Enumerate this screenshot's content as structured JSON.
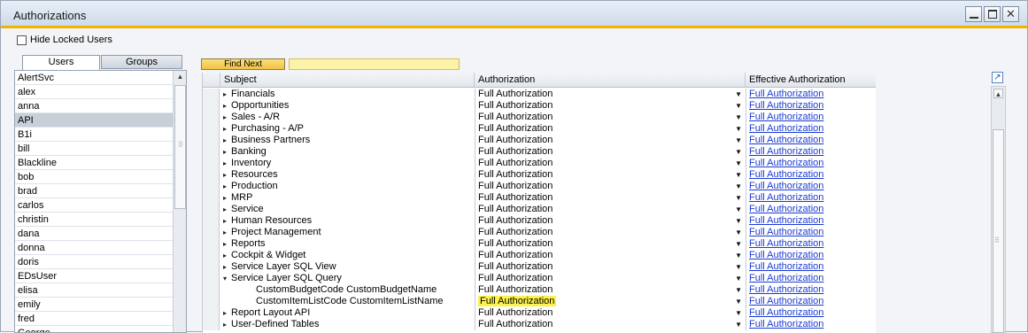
{
  "window": {
    "title": "Authorizations",
    "minimize_glyph": "",
    "maximize_glyph": "",
    "close_glyph": "✕"
  },
  "filter": {
    "hide_locked_label": "Hide Locked Users",
    "hide_locked_checked": false
  },
  "tabs": [
    {
      "label": "Users",
      "active": true
    },
    {
      "label": "Groups",
      "active": false
    }
  ],
  "users": [
    "AlertSvc",
    "alex",
    "anna",
    "API",
    "B1i",
    "bill",
    "Blackline",
    "bob",
    "brad",
    "carlos",
    "christin",
    "dana",
    "donna",
    "doris",
    "EDsUser",
    "elisa",
    "emily",
    "fred",
    "George"
  ],
  "selected_user": "API",
  "find": {
    "button_label": "Find Next",
    "field_value": ""
  },
  "grid": {
    "columns": {
      "subject": "Subject",
      "authorization": "Authorization",
      "effective": "Effective Authorization"
    },
    "rows": [
      {
        "subject": "Financials",
        "auth": "Full Authorization",
        "eff": "Full Authorization",
        "exp": "▸",
        "child": false
      },
      {
        "subject": "Opportunities",
        "auth": "Full Authorization",
        "eff": "Full Authorization",
        "exp": "▸",
        "child": false
      },
      {
        "subject": "Sales - A/R",
        "auth": "Full Authorization",
        "eff": "Full Authorization",
        "exp": "▸",
        "child": false
      },
      {
        "subject": "Purchasing - A/P",
        "auth": "Full Authorization",
        "eff": "Full Authorization",
        "exp": "▸",
        "child": false
      },
      {
        "subject": "Business Partners",
        "auth": "Full Authorization",
        "eff": "Full Authorization",
        "exp": "▸",
        "child": false
      },
      {
        "subject": "Banking",
        "auth": "Full Authorization",
        "eff": "Full Authorization",
        "exp": "▸",
        "child": false
      },
      {
        "subject": "Inventory",
        "auth": "Full Authorization",
        "eff": "Full Authorization",
        "exp": "▸",
        "child": false
      },
      {
        "subject": "Resources",
        "auth": "Full Authorization",
        "eff": "Full Authorization",
        "exp": "▸",
        "child": false
      },
      {
        "subject": "Production",
        "auth": "Full Authorization",
        "eff": "Full Authorization",
        "exp": "▸",
        "child": false
      },
      {
        "subject": "MRP",
        "auth": "Full Authorization",
        "eff": "Full Authorization",
        "exp": "▸",
        "child": false
      },
      {
        "subject": "Service",
        "auth": "Full Authorization",
        "eff": "Full Authorization",
        "exp": "▸",
        "child": false
      },
      {
        "subject": "Human Resources",
        "auth": "Full Authorization",
        "eff": "Full Authorization",
        "exp": "▸",
        "child": false
      },
      {
        "subject": "Project Management",
        "auth": "Full Authorization",
        "eff": "Full Authorization",
        "exp": "▸",
        "child": false
      },
      {
        "subject": "Reports",
        "auth": "Full Authorization",
        "eff": "Full Authorization",
        "exp": "▸",
        "child": false
      },
      {
        "subject": "Cockpit & Widget",
        "auth": "Full Authorization",
        "eff": "Full Authorization",
        "exp": "▸",
        "child": false
      },
      {
        "subject": "Service Layer SQL View",
        "auth": "Full Authorization",
        "eff": "Full Authorization",
        "exp": "▸",
        "child": false
      },
      {
        "subject": "Service Layer SQL Query",
        "auth": "Full Authorization",
        "eff": "Full Authorization",
        "exp": "▾",
        "child": false
      },
      {
        "subject": "CustomBudgetCode CustomBudgetName",
        "auth": "Full Authorization",
        "eff": "Full Authorization",
        "exp": "",
        "child": true
      },
      {
        "subject": "CustomItemListCode CustomItemListName",
        "auth": "Full Authorization",
        "eff": "Full Authorization",
        "exp": "",
        "child": true,
        "highlight": true
      },
      {
        "subject": "Report Layout API",
        "auth": "Full Authorization",
        "eff": "Full Authorization",
        "exp": "▸",
        "child": false
      },
      {
        "subject": "User-Defined Tables",
        "auth": "Full Authorization",
        "eff": "Full Authorization",
        "exp": "▸",
        "child": false
      }
    ]
  },
  "icons": {
    "dropdown": "▼",
    "scroll_up": "▲",
    "expand_window": "↗",
    "grip": "⠿"
  }
}
